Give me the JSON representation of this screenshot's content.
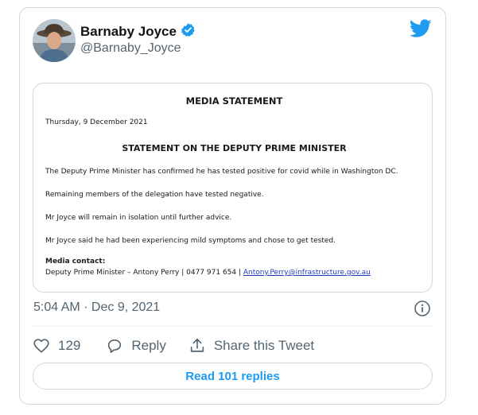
{
  "author": {
    "name": "Barnaby Joyce",
    "handle": "@Barnaby_Joyce",
    "verified": true
  },
  "media": {
    "heading": "MEDIA STATEMENT",
    "date": "Thursday, 9 December 2021",
    "title": "STATEMENT ON THE DEPUTY PRIME MINISTER",
    "paragraphs": [
      "The Deputy Prime Minister has confirmed he has tested positive for covid while in Washington DC.",
      "Remaining members of the delegation have tested negative.",
      "Mr Joyce will remain in isolation until further advice.",
      "Mr Joyce said he had been experiencing mild symptoms and chose to get tested."
    ],
    "contact_label": "Media contact:",
    "contact_line": "Deputy Prime Minister – Antony Perry | 0477 971 654 | ",
    "contact_email": "Antony.Perry@infrastructure.gov.au"
  },
  "timestamp": "5:04 AM · Dec 9, 2021",
  "actions": {
    "like_count": "129",
    "reply_label": "Reply",
    "share_label": "Share this Tweet"
  },
  "read_replies_label": "Read 101 replies",
  "colors": {
    "accent": "#1d9bf0",
    "verified": "#1d9bf0",
    "muted_text": "#536471",
    "border": "#cfd9de"
  },
  "icons": {
    "brand": "twitter-bird-icon",
    "verified": "verified-badge-icon",
    "info": "info-icon",
    "like": "heart-icon",
    "reply": "reply-bubble-icon",
    "share": "share-icon"
  }
}
